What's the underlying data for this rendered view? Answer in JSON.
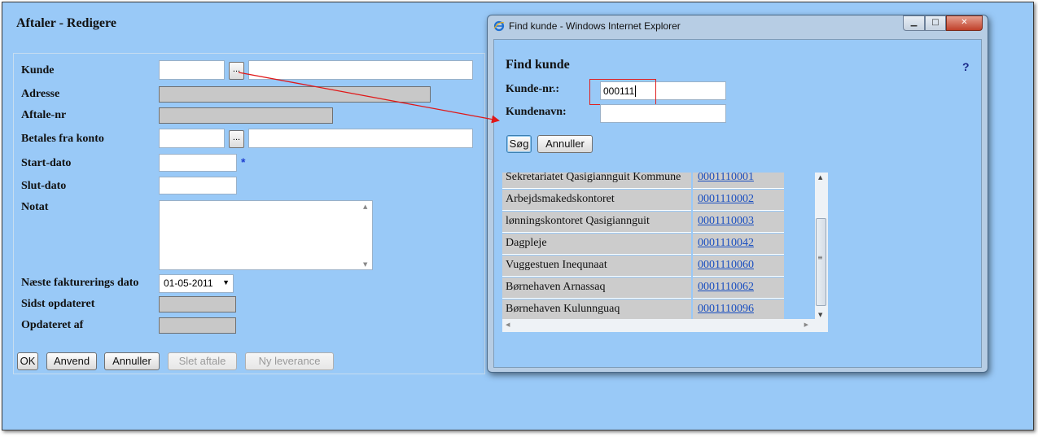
{
  "main": {
    "title": "Aftaler - Redigere",
    "labels": {
      "kunde": "Kunde",
      "adresse": "Adresse",
      "aftale_nr": "Aftale-nr",
      "betales_fra_konto": "Betales fra konto",
      "start_dato": "Start-dato",
      "slut_dato": "Slut-dato",
      "notat": "Notat",
      "naeste_fakturerings_dato": "Næste fakturerings dato",
      "sidst_opdateret": "Sidst opdateret",
      "opdateret_af": "Opdateret af"
    },
    "dots_label": "...",
    "required_marker": "*",
    "next_invoice_date": "01-05-2011",
    "buttons": {
      "ok": "OK",
      "anvend": "Anvend",
      "annuller": "Annuller",
      "slet_aftale": "Slet aftale",
      "ny_leverance": "Ny leverance"
    }
  },
  "popup": {
    "window_title": "Find kunde - Windows Internet Explorer",
    "heading": "Find kunde",
    "help": "?",
    "kunde_nr_label": "Kunde-nr.:",
    "kundenavn_label": "Kundenavn:",
    "kunde_nr_value": "000111",
    "kundenavn_value": "",
    "search_button": "Søg",
    "cancel_button": "Annuller",
    "results": [
      {
        "name": "Sekretariatet Qasigiannguit Kommune",
        "number": "0001110001"
      },
      {
        "name": "Arbejdsmakedskontoret",
        "number": "0001110002"
      },
      {
        "name": "lønningskontoret Qasigiannguit",
        "number": "0001110003"
      },
      {
        "name": "Dagpleje",
        "number": "0001110042"
      },
      {
        "name": "Vuggestuen Inequnaat",
        "number": "0001110060"
      },
      {
        "name": "Børnehaven Arnassaq",
        "number": "0001110062"
      },
      {
        "name": "Børnehaven Kulunnguaq",
        "number": "0001110096"
      }
    ]
  },
  "colors": {
    "background": "#99c9f7",
    "link": "#1a4fc0",
    "highlight": "#e02020"
  }
}
